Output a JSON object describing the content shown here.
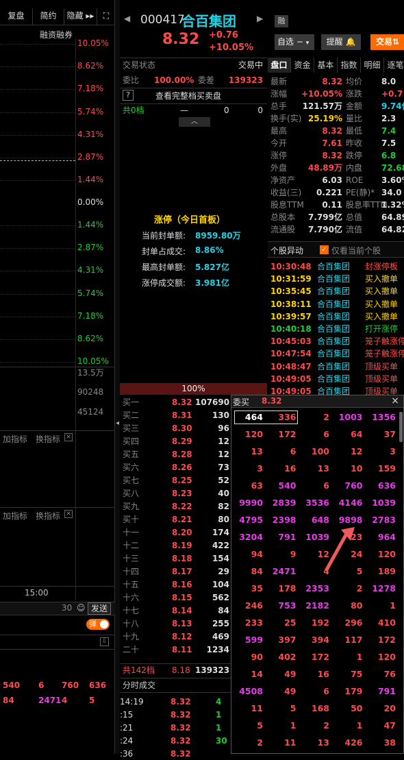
{
  "left": {
    "buttons": [
      "复盘",
      "简约",
      "隐藏 ▸▸"
    ],
    "margin_label": "融资融券",
    "ticks_up": [
      "10.05%",
      "8.62%",
      "7.18%",
      "5.74%",
      "4.31%",
      "2.87%",
      "1.44%"
    ],
    "tick_zero": "0.00%",
    "ticks_down": [
      "1.44%",
      "2.87%",
      "4.31%",
      "5.74%",
      "7.18%",
      "8.62%",
      "10.05%"
    ],
    "vol_ticks": [
      "13.5万",
      "90248",
      "45124"
    ],
    "indicator_add": "加指标",
    "indicator_switch": "换指标",
    "time_label": "15:00",
    "input_count": "30",
    "send": "发送",
    "popup_toggle": "弹",
    "bottom_rows": [
      [
        "540",
        "6",
        "760",
        "636"
      ],
      [
        "84",
        "2471",
        "4",
        "5"
      ]
    ]
  },
  "stock": {
    "code": "000417",
    "name": "合百集团",
    "tag": "融",
    "price": "8.32",
    "change": "+0.76",
    "pct": "+10.05%",
    "watch": "自选",
    "watch_arrow": "−",
    "alert": "提醒",
    "trade": "交易"
  },
  "order": {
    "status_label": "交易状态",
    "status_value": "交易中",
    "ratio_label": "委比",
    "ratio_value": "100.00%",
    "diff_label": "委差",
    "diff_value": "139323",
    "full_label": "查看完整档买卖盘",
    "sell_total_label": "共0档",
    "sell_dash": "—",
    "sell_zero1": "0",
    "sell_zero2": "0",
    "limit_title": "涨停（今日首板）",
    "limit_rows": [
      {
        "label": "当前封单额:",
        "value": "8959.80万"
      },
      {
        "label": "封单占成交:",
        "value": "8.86%"
      },
      {
        "label": "最高封单额:",
        "value": "5.827亿"
      },
      {
        "label": "涨停成交额:",
        "value": "3.981亿"
      }
    ],
    "percent_bar": "100%",
    "buy_total_label": "共142档",
    "buy_total_price": "8.18",
    "buy_total_vol": "139323",
    "trade_title": "分时成交"
  },
  "bids": [
    [
      "买一",
      "8.32",
      "107690"
    ],
    [
      "买二",
      "8.31",
      "130"
    ],
    [
      "买三",
      "8.30",
      "96"
    ],
    [
      "买四",
      "8.29",
      "12"
    ],
    [
      "买五",
      "8.28",
      "12"
    ],
    [
      "买六",
      "8.26",
      "73"
    ],
    [
      "买七",
      "8.25",
      "52"
    ],
    [
      "买八",
      "8.23",
      "40"
    ],
    [
      "买九",
      "8.22",
      "82"
    ],
    [
      "买十",
      "8.21",
      "80"
    ],
    [
      "十一",
      "8.20",
      "174"
    ],
    [
      "十二",
      "8.19",
      "422"
    ],
    [
      "十三",
      "8.18",
      "154"
    ],
    [
      "十四",
      "8.17",
      "29"
    ],
    [
      "十五",
      "8.16",
      "104"
    ],
    [
      "十六",
      "8.15",
      "562"
    ],
    [
      "十七",
      "8.14",
      "84"
    ],
    [
      "十八",
      "8.13",
      "255"
    ],
    [
      "十九",
      "8.12",
      "469"
    ],
    [
      "二十",
      "8.11",
      "1234"
    ]
  ],
  "trades": [
    [
      "14:19",
      "8.32",
      "4"
    ],
    [
      ":15",
      "8.32",
      "1"
    ],
    [
      ":21",
      "8.32",
      "1"
    ],
    [
      ":24",
      "8.32",
      "30"
    ],
    [
      ":36",
      "8.32",
      ""
    ]
  ],
  "tabs": [
    "盘口",
    "资金",
    "基本",
    "指数",
    "明细",
    "逐笔"
  ],
  "quote": [
    [
      "最新",
      "8.32",
      "均价",
      "8.0"
    ],
    [
      "涨幅",
      "+10.05%",
      "涨跌",
      "+0.7"
    ],
    [
      "总手",
      "121.57万",
      "金额",
      "9.74亿"
    ],
    [
      "换手(实)",
      "25.19%",
      "量比",
      "2.3"
    ],
    [
      "最高",
      "8.32",
      "最低",
      "7.4"
    ],
    [
      "今开",
      "7.61",
      "昨收",
      "7.5"
    ],
    [
      "涨停",
      "8.32",
      "跌停",
      "6.8"
    ],
    [
      "外盘",
      "48.89万",
      "内盘",
      "72.68万"
    ],
    [
      "净资产",
      "6.03",
      "ROE",
      "3.60%"
    ],
    [
      "收益(三)",
      "0.221",
      "PE(静)*",
      "34.0"
    ],
    [
      "股息TTM",
      "0.11",
      "股息率TTM",
      "1.32%"
    ],
    [
      "总股本",
      "7.799亿",
      "总值",
      "64.89亿"
    ],
    [
      "流通股",
      "7.790亿",
      "流值",
      "64.82亿"
    ]
  ],
  "move": {
    "title": "个股异动",
    "checkbox_label": "仅看当前个股",
    "items": [
      [
        "10:30:48",
        "合百集团",
        "封涨停板"
      ],
      [
        "10:31:59",
        "合百集团",
        "买入撤单"
      ],
      [
        "10:35:45",
        "合百集团",
        "买入撤单"
      ],
      [
        "10:38:11",
        "合百集团",
        "买入撤单"
      ],
      [
        "10:39:57",
        "合百集团",
        "买入撤单"
      ],
      [
        "10:40:18",
        "合百集团",
        "打开涨停"
      ],
      [
        "10:45:03",
        "合百集团",
        "笼子触涨停"
      ],
      [
        "10:47:54",
        "合百集团",
        "笼子触涨停"
      ],
      [
        "10:48:47",
        "合百集团",
        "顶级买单"
      ],
      [
        "10:49:05",
        "合百集团",
        "顶级买单"
      ],
      [
        "10:49:05",
        "合百集团",
        "顶级买单"
      ]
    ]
  },
  "queue": {
    "title": "委买",
    "price": "8.32",
    "close": "×",
    "rows": [
      [
        "464",
        "336",
        "2",
        "1003",
        "1356"
      ],
      [
        "120",
        "172",
        "6",
        "64",
        "37"
      ],
      [
        "13",
        "6",
        "100",
        "12",
        "3"
      ],
      [
        "3",
        "16",
        "13",
        "10",
        "159"
      ],
      [
        "63",
        "540",
        "6",
        "760",
        "636"
      ],
      [
        "9990",
        "2839",
        "3536",
        "4146",
        "1039"
      ],
      [
        "4795",
        "2398",
        "648",
        "9898",
        "2783"
      ],
      [
        "3204",
        "791",
        "1039",
        "23",
        "964"
      ],
      [
        "94",
        "9",
        "12",
        "24",
        "120"
      ],
      [
        "84",
        "2471",
        "4",
        "5",
        "189"
      ],
      [
        "35",
        "178",
        "2353",
        "2",
        "1278"
      ],
      [
        "246",
        "753",
        "2182",
        "80",
        "1"
      ],
      [
        "233",
        "25",
        "192",
        "296",
        "410"
      ],
      [
        "599",
        "397",
        "394",
        "117",
        "172"
      ],
      [
        "90",
        "402",
        "172",
        "1",
        "120"
      ],
      [
        "14",
        "49",
        "16",
        "75",
        "76"
      ],
      [
        "4508",
        "49",
        "6",
        "179",
        "791"
      ],
      [
        "11",
        "5",
        "168",
        "50",
        "20"
      ],
      [
        "5",
        "1",
        "2",
        "1",
        "47"
      ],
      [
        "2",
        "11",
        "13",
        "426",
        "38"
      ]
    ]
  },
  "colors": {
    "up": "#ff4a4a",
    "down": "#22cc33",
    "large": "#e83ae8",
    "accent": "#ff6a00"
  }
}
